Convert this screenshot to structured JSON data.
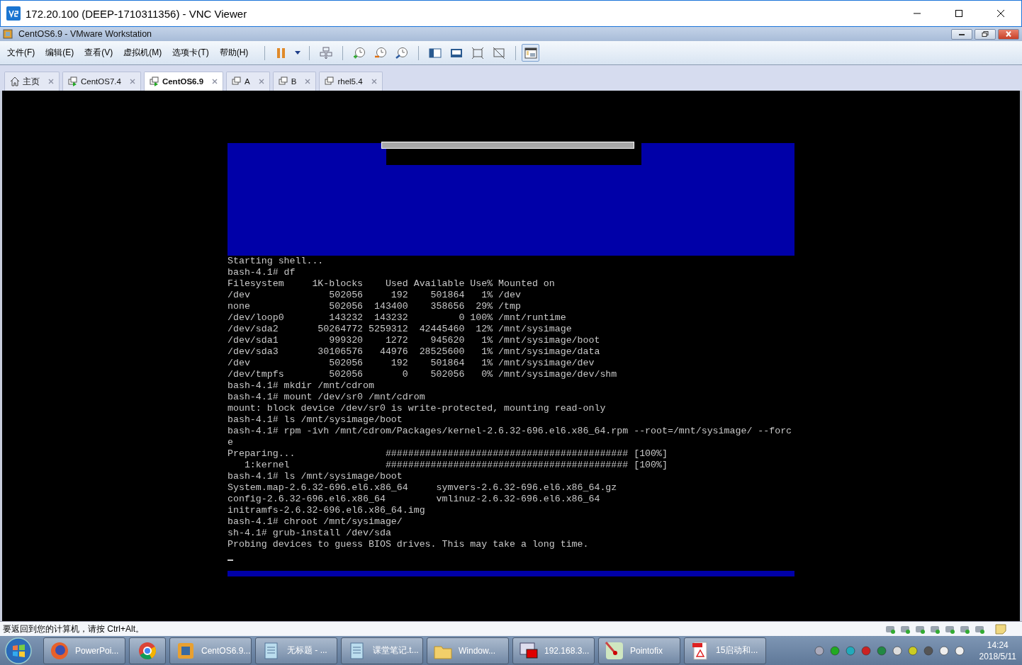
{
  "vnc_window": {
    "title": "172.20.100 (DEEP-1710311356) - VNC Viewer"
  },
  "vmware_window": {
    "title": "CentOS6.9 - VMware Workstation"
  },
  "menu": [
    "文件(F)",
    "编辑(E)",
    "查看(V)",
    "虚拟机(M)",
    "选项卡(T)",
    "帮助(H)"
  ],
  "tabs": [
    {
      "label": "主页",
      "kind": "home",
      "selected": false
    },
    {
      "label": "CentOS7.4",
      "kind": "vm-running",
      "selected": false
    },
    {
      "label": "CentOS6.9",
      "kind": "vm-running",
      "selected": true
    },
    {
      "label": "A",
      "kind": "vm",
      "selected": false
    },
    {
      "label": "B",
      "kind": "vm",
      "selected": false
    },
    {
      "label": "rhel5.4",
      "kind": "vm",
      "selected": false
    }
  ],
  "console": {
    "lines": [
      "Starting shell...",
      "bash-4.1# df",
      "Filesystem     1K-blocks    Used Available Use% Mounted on",
      "/dev              502056     192    501864   1% /dev",
      "none              502056  143400    358656  29% /tmp",
      "/dev/loop0        143232  143232         0 100% /mnt/runtime",
      "/dev/sda2       50264772 5259312  42445460  12% /mnt/sysimage",
      "/dev/sda1         999320    1272    945620   1% /mnt/sysimage/boot",
      "/dev/sda3       30106576   44976  28525600   1% /mnt/sysimage/data",
      "/dev              502056     192    501864   1% /mnt/sysimage/dev",
      "/dev/tmpfs        502056       0    502056   0% /mnt/sysimage/dev/shm",
      "bash-4.1# mkdir /mnt/cdrom",
      "bash-4.1# mount /dev/sr0 /mnt/cdrom",
      "mount: block device /dev/sr0 is write-protected, mounting read-only",
      "bash-4.1# ls /mnt/sysimage/boot",
      "bash-4.1# rpm -ivh /mnt/cdrom/Packages/kernel-2.6.32-696.el6.x86_64.rpm --root=/mnt/sysimage/ --forc",
      "e",
      "Preparing...                ########################################### [100%]",
      "   1:kernel                 ########################################### [100%]",
      "bash-4.1# ls /mnt/sysimage/boot",
      "System.map-2.6.32-696.el6.x86_64     symvers-2.6.32-696.el6.x86_64.gz",
      "config-2.6.32-696.el6.x86_64         vmlinuz-2.6.32-696.el6.x86_64",
      "initramfs-2.6.32-696.el6.x86_64.img",
      "bash-4.1# chroot /mnt/sysimage/",
      "sh-4.1# grub-install /dev/sda",
      "Probing devices to guess BIOS drives. This may take a long time."
    ]
  },
  "status_bar": {
    "text": "要返回到您的计算机，请按 Ctrl+Alt。"
  },
  "taskbar": {
    "items": [
      {
        "label": "PowerPoi...",
        "kind": "firefox"
      },
      {
        "kind": "chrome"
      },
      {
        "label": "CentOS6.9...",
        "kind": "vmware"
      },
      {
        "label": "无标题 - ...",
        "kind": "notepad"
      },
      {
        "label": "课堂笔记.t...",
        "kind": "notepad"
      },
      {
        "label": "Window...",
        "kind": "folder"
      },
      {
        "label": "192.168.3...",
        "kind": "remote"
      },
      {
        "label": "Pointofix",
        "kind": "pointofix"
      },
      {
        "label": "15启动和...",
        "kind": "pdf"
      }
    ],
    "clock": {
      "time": "14:24",
      "date": "2018/5/11"
    }
  }
}
